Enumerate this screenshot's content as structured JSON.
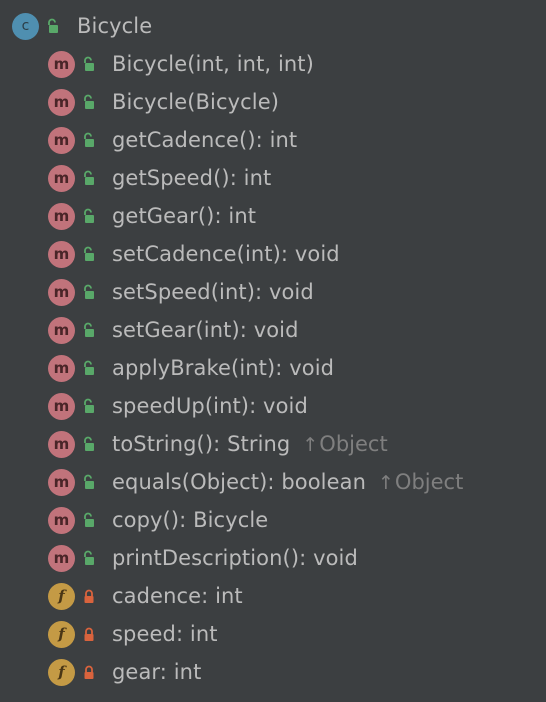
{
  "class": {
    "name": "Bicycle",
    "icon": "class-icon",
    "badge_letter": "c",
    "visibility": "public"
  },
  "members": [
    {
      "kind": "method",
      "badge_letter": "m",
      "visibility": "public",
      "signature": "Bicycle(int, int, int)",
      "inherited_from": ""
    },
    {
      "kind": "method",
      "badge_letter": "m",
      "visibility": "public",
      "signature": "Bicycle(Bicycle)",
      "inherited_from": ""
    },
    {
      "kind": "method",
      "badge_letter": "m",
      "visibility": "public",
      "signature": "getCadence(): int",
      "inherited_from": ""
    },
    {
      "kind": "method",
      "badge_letter": "m",
      "visibility": "public",
      "signature": "getSpeed(): int",
      "inherited_from": ""
    },
    {
      "kind": "method",
      "badge_letter": "m",
      "visibility": "public",
      "signature": "getGear(): int",
      "inherited_from": ""
    },
    {
      "kind": "method",
      "badge_letter": "m",
      "visibility": "public",
      "signature": "setCadence(int): void",
      "inherited_from": ""
    },
    {
      "kind": "method",
      "badge_letter": "m",
      "visibility": "public",
      "signature": "setSpeed(int): void",
      "inherited_from": ""
    },
    {
      "kind": "method",
      "badge_letter": "m",
      "visibility": "public",
      "signature": "setGear(int): void",
      "inherited_from": ""
    },
    {
      "kind": "method",
      "badge_letter": "m",
      "visibility": "public",
      "signature": "applyBrake(int): void",
      "inherited_from": ""
    },
    {
      "kind": "method",
      "badge_letter": "m",
      "visibility": "public",
      "signature": "speedUp(int): void",
      "inherited_from": ""
    },
    {
      "kind": "method",
      "badge_letter": "m",
      "visibility": "public",
      "signature": "toString(): String",
      "inherited_from": "Object"
    },
    {
      "kind": "method",
      "badge_letter": "m",
      "visibility": "public",
      "signature": "equals(Object): boolean",
      "inherited_from": "Object"
    },
    {
      "kind": "method",
      "badge_letter": "m",
      "visibility": "public",
      "signature": "copy(): Bicycle",
      "inherited_from": ""
    },
    {
      "kind": "method",
      "badge_letter": "m",
      "visibility": "public",
      "signature": "printDescription(): void",
      "inherited_from": ""
    },
    {
      "kind": "field",
      "badge_letter": "f",
      "visibility": "private",
      "signature": "cadence: int",
      "inherited_from": ""
    },
    {
      "kind": "field",
      "badge_letter": "f",
      "visibility": "private",
      "signature": "speed: int",
      "inherited_from": ""
    },
    {
      "kind": "field",
      "badge_letter": "f",
      "visibility": "private",
      "signature": "gear: int",
      "inherited_from": ""
    }
  ],
  "inherit_arrow": "↑",
  "colors": {
    "background": "#3c3f41",
    "text": "#bbbbbb",
    "inherited_text": "#7f7f7f",
    "class_badge": "#4f8fb0",
    "method_badge": "#c1737b",
    "field_badge": "#c49a45",
    "public_lock": "#59a869",
    "private_lock": "#d9633d"
  }
}
